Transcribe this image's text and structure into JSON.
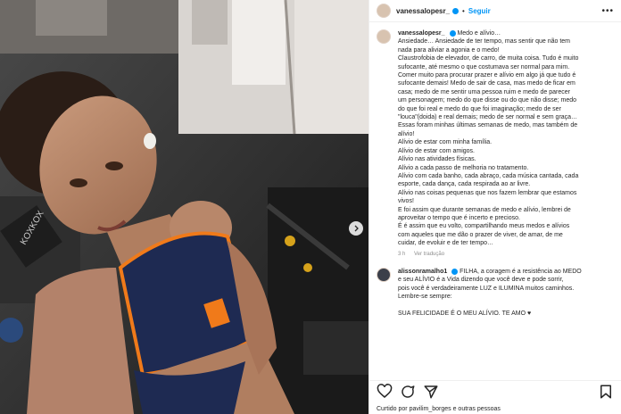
{
  "photo": {
    "brand_text": "KOXKOX"
  },
  "header": {
    "username": "vanessalopesr_",
    "separator": "•",
    "follow_label": "Seguir",
    "more_label": "•••"
  },
  "caption": {
    "username": "vanessalopesr_",
    "lines": [
      "Medo e alívio…",
      "Ansiedade… Ansiedade de ter tempo, mas sentir que não tem",
      "nada para aliviar a agonia e o medo!",
      "Claustrofobia de elevador, de carro, de muita coisa. Tudo é muito",
      "sufocante, até mesmo o que costumava ser normal para mim.",
      "Comer muito para procurar prazer e alívio em algo já que tudo é",
      "sufocante demais! Medo de sair de casa, mas medo de ficar em",
      "casa; medo de me sentir uma pessoa ruim e medo de parecer",
      "um personagem; medo do que disse ou do que não disse; medo",
      "do que foi real e medo do que foi imaginação; medo de ser",
      "\"louca\"(doida) e real demais; medo de ser normal e sem graça…",
      "Essas foram minhas últimas semanas de medo, mas também de",
      "alívio!",
      "Alívio de estar com minha família.",
      "Alívio de estar com amigos.",
      "Alívio nas atividades físicas.",
      "Alívio a cada passo de melhoria no tratamento.",
      "Alívio com cada banho, cada abraço, cada música cantada, cada",
      "esporte, cada dança, cada respirada ao ar livre.",
      "Alívio nas coisas pequenas que nos fazem lembrar que estamos",
      "vivos!",
      "E foi assim que durante semanas de medo e alívio, lembrei de",
      "aproveitar o tempo que é incerto e precioso.",
      "É é assim que eu volto, compartilhando meus medos e alívios",
      "com aqueles que me dão o prazer de viver, de amar, de me",
      "cuidar, de evoluir e de ter tempo…"
    ],
    "time": "3 h",
    "translate_label": "Ver tradução"
  },
  "comment": {
    "username": "alissonramalho1",
    "lines": [
      "FILHA, a coragem é a resistência ao MEDO",
      "e seu ALÍVIO é a Vida dizendo que você deve e pode sorrir,",
      "pois você é verdadeiramente LUZ e ILUMINA muitos caminhos.",
      "Lembre-se sempre:"
    ],
    "final_line": "SUA FELICIDADE É O MEU ALÍVIO. TE AMO ♥"
  },
  "likes_text": "Curtido por pavilim_borges e outras pessoas",
  "colors": {
    "accent": "#0095f6",
    "top_navy": "#1e2a52",
    "trim_orange": "#f07a1a"
  },
  "icons": [
    "heart-icon",
    "comment-icon",
    "share-icon",
    "bookmark-icon",
    "chevron-right-icon",
    "verified-icon"
  ]
}
